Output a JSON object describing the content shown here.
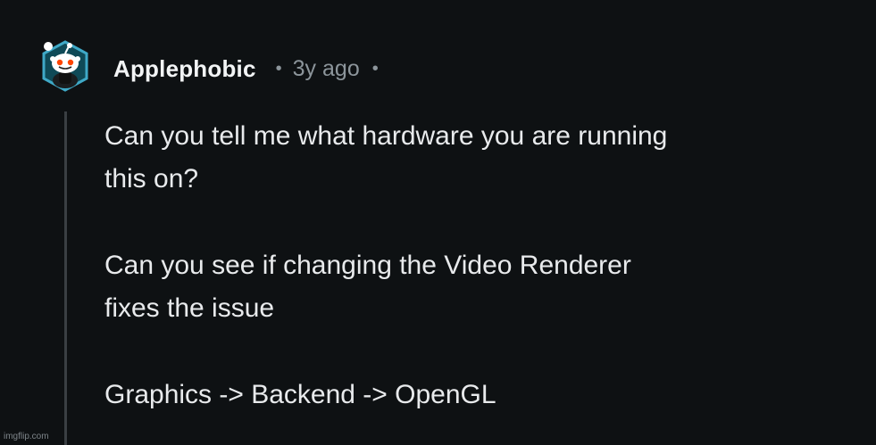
{
  "comment": {
    "username": "Applephobic",
    "separator": "•",
    "timestamp": "3y ago",
    "paragraphs": [
      "Can you tell me what hardware you are running\nthis on?",
      "Can you see if changing the Video Renderer\nfixes the issue",
      "Graphics -> Backend -> OpenGL"
    ]
  },
  "avatar": {
    "icon": "snoo-avatar-icon",
    "hex_border_color": "#3fa9c7"
  },
  "watermark": "imgflip.com"
}
